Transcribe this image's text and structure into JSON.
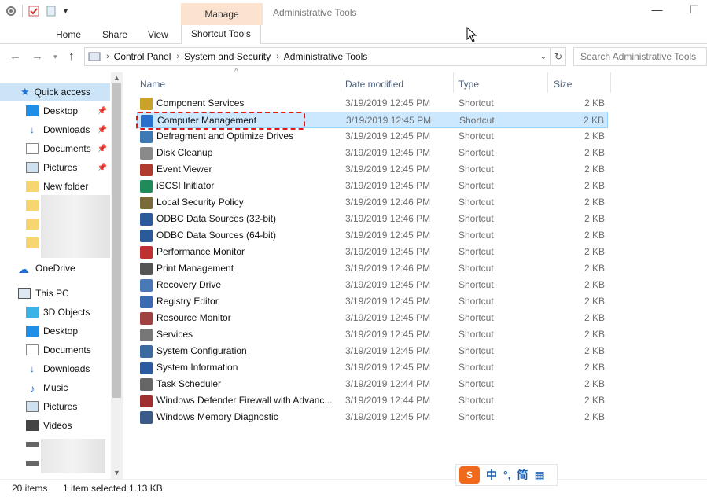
{
  "window": {
    "title": "Administrative Tools",
    "manage_tab": "Manage",
    "minimize": "—",
    "maximize": "☐"
  },
  "ribbon": {
    "tabs": [
      "Home",
      "Share",
      "View"
    ],
    "contextual_tab": "Shortcut Tools"
  },
  "address": {
    "crumbs": [
      "Control Panel",
      "System and Security",
      "Administrative Tools"
    ],
    "search_placeholder": "Search Administrative Tools"
  },
  "nav": {
    "quick_access": "Quick access",
    "quick_items": [
      "Desktop",
      "Downloads",
      "Documents",
      "Pictures",
      "New folder"
    ],
    "onedrive": "OneDrive",
    "this_pc": "This PC",
    "pc_items": [
      "3D Objects",
      "Desktop",
      "Documents",
      "Downloads",
      "Music",
      "Pictures",
      "Videos"
    ]
  },
  "columns": {
    "name": "Name",
    "date": "Date modified",
    "type": "Type",
    "size": "Size"
  },
  "files": [
    {
      "name": "Component Services",
      "date": "3/19/2019 12:45 PM",
      "type": "Shortcut",
      "size": "2 KB"
    },
    {
      "name": "Computer Management",
      "date": "3/19/2019 12:45 PM",
      "type": "Shortcut",
      "size": "2 KB",
      "selected": true
    },
    {
      "name": "Defragment and Optimize Drives",
      "date": "3/19/2019 12:45 PM",
      "type": "Shortcut",
      "size": "2 KB"
    },
    {
      "name": "Disk Cleanup",
      "date": "3/19/2019 12:45 PM",
      "type": "Shortcut",
      "size": "2 KB"
    },
    {
      "name": "Event Viewer",
      "date": "3/19/2019 12:45 PM",
      "type": "Shortcut",
      "size": "2 KB"
    },
    {
      "name": "iSCSI Initiator",
      "date": "3/19/2019 12:45 PM",
      "type": "Shortcut",
      "size": "2 KB"
    },
    {
      "name": "Local Security Policy",
      "date": "3/19/2019 12:46 PM",
      "type": "Shortcut",
      "size": "2 KB"
    },
    {
      "name": "ODBC Data Sources (32-bit)",
      "date": "3/19/2019 12:46 PM",
      "type": "Shortcut",
      "size": "2 KB"
    },
    {
      "name": "ODBC Data Sources (64-bit)",
      "date": "3/19/2019 12:45 PM",
      "type": "Shortcut",
      "size": "2 KB"
    },
    {
      "name": "Performance Monitor",
      "date": "3/19/2019 12:45 PM",
      "type": "Shortcut",
      "size": "2 KB"
    },
    {
      "name": "Print Management",
      "date": "3/19/2019 12:46 PM",
      "type": "Shortcut",
      "size": "2 KB"
    },
    {
      "name": "Recovery Drive",
      "date": "3/19/2019 12:45 PM",
      "type": "Shortcut",
      "size": "2 KB"
    },
    {
      "name": "Registry Editor",
      "date": "3/19/2019 12:45 PM",
      "type": "Shortcut",
      "size": "2 KB"
    },
    {
      "name": "Resource Monitor",
      "date": "3/19/2019 12:45 PM",
      "type": "Shortcut",
      "size": "2 KB"
    },
    {
      "name": "Services",
      "date": "3/19/2019 12:45 PM",
      "type": "Shortcut",
      "size": "2 KB"
    },
    {
      "name": "System Configuration",
      "date": "3/19/2019 12:45 PM",
      "type": "Shortcut",
      "size": "2 KB"
    },
    {
      "name": "System Information",
      "date": "3/19/2019 12:45 PM",
      "type": "Shortcut",
      "size": "2 KB"
    },
    {
      "name": "Task Scheduler",
      "date": "3/19/2019 12:44 PM",
      "type": "Shortcut",
      "size": "2 KB"
    },
    {
      "name": "Windows Defender Firewall with Advanc...",
      "date": "3/19/2019 12:44 PM",
      "type": "Shortcut",
      "size": "2 KB"
    },
    {
      "name": "Windows Memory Diagnostic",
      "date": "3/19/2019 12:45 PM",
      "type": "Shortcut",
      "size": "2 KB"
    }
  ],
  "status": {
    "count": "20 items",
    "selection": "1 item selected  1.13 KB"
  },
  "ime": {
    "logo": "S",
    "chars": [
      "中",
      "°,",
      "简"
    ]
  },
  "colors": {
    "selected_bg": "#cce8ff",
    "highlight_border": "#e01919",
    "manage_tab_bg": "#fbe3d0"
  }
}
